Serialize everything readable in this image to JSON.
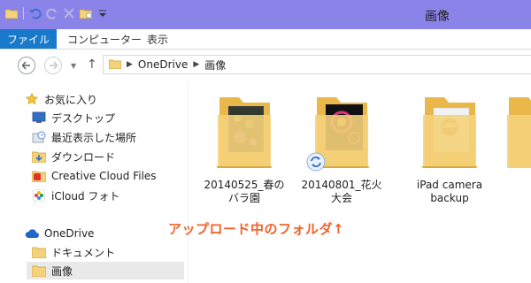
{
  "window": {
    "title": "画像"
  },
  "ribbon": {
    "tabs": [
      "ファイル",
      "コンピューター",
      "表示"
    ]
  },
  "address": {
    "crumbs": [
      "OneDrive",
      "画像"
    ]
  },
  "sidebar": {
    "favorites": [
      {
        "label": "お気に入り",
        "icon": "star-icon"
      },
      {
        "label": "デスクトップ",
        "icon": "desktop-icon"
      },
      {
        "label": "最近表示した場所",
        "icon": "recent-places-icon"
      },
      {
        "label": "ダウンロード",
        "icon": "download-folder-icon"
      },
      {
        "label": "Creative Cloud Files",
        "icon": "creative-cloud-icon"
      },
      {
        "label": "iCloud フォト",
        "icon": "icloud-photos-icon"
      }
    ],
    "onedrive": {
      "label": "OneDrive",
      "icon": "cloud-icon"
    },
    "onedrive_children": [
      {
        "label": "ドキュメント",
        "icon": "folder-icon"
      },
      {
        "label": "画像",
        "icon": "folder-icon"
      }
    ]
  },
  "folders": [
    {
      "line1": "20140525_春の",
      "line2": "バラ園",
      "sync": false
    },
    {
      "line1": "20140801_花火",
      "line2": "大会",
      "sync": true
    },
    {
      "line1": "iPad camera",
      "line2": "backup",
      "sync": false
    }
  ],
  "annotation": "アップロード中のフォルダ↑",
  "colors": {
    "titlebar": "#8b84e8",
    "file_tab": "#1979ca",
    "annotation": "#f0622b",
    "folder": "#f5d27a"
  }
}
